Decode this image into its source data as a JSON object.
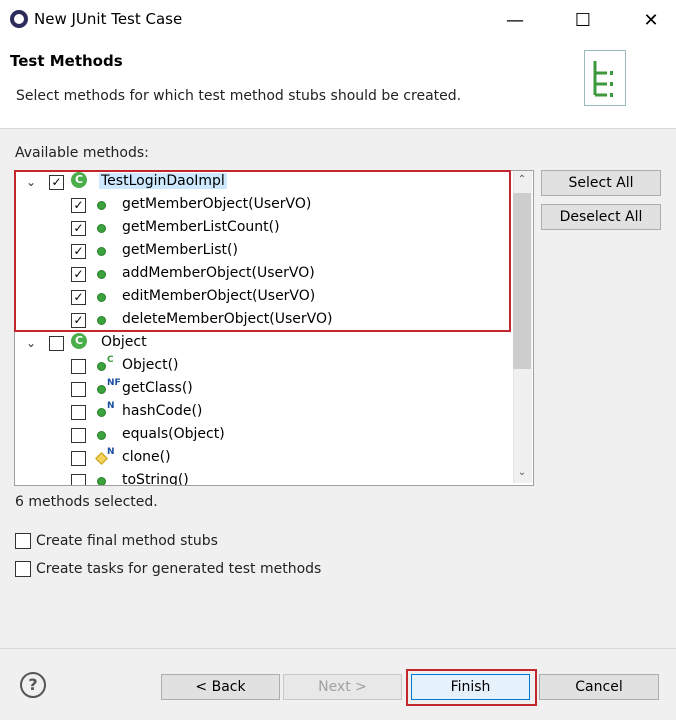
{
  "window": {
    "title": "New JUnit Test Case"
  },
  "header": {
    "title": "Test Methods",
    "description": "Select methods for which test method stubs should be created."
  },
  "main": {
    "available_label": "Available methods:",
    "selection_status": "6 methods selected."
  },
  "tree": {
    "class_node": {
      "name": "TestLoginDaoImpl",
      "checked": true,
      "expanded": true
    },
    "class_methods": [
      "getMemberObject(UserVO)",
      "getMemberListCount()",
      "getMemberList()",
      "addMemberObject(UserVO)",
      "editMemberObject(UserVO)",
      "deleteMemberObject(UserVO)"
    ],
    "object_node": {
      "name": "Object",
      "checked": false,
      "expanded": true
    },
    "object_methods": [
      {
        "label": "Object()",
        "badge": "C"
      },
      {
        "label": "getClass()",
        "badge": "NF"
      },
      {
        "label": "hashCode()",
        "badge": "N"
      },
      {
        "label": "equals(Object)",
        "badge": ""
      },
      {
        "label": "clone()",
        "badge": "N"
      },
      {
        "label": "toString()",
        "badge": ""
      }
    ]
  },
  "side_buttons": {
    "select_all": "Select All",
    "deselect_all": "Deselect All"
  },
  "options": {
    "final_stubs": "Create final method stubs",
    "tasks": "Create tasks for generated test methods"
  },
  "footer": {
    "back": "< Back",
    "next": "Next >",
    "finish": "Finish",
    "cancel": "Cancel"
  },
  "icons": {
    "app": "eclipse-icon",
    "minimize": "minimize-icon",
    "maximize": "maximize-icon",
    "close": "close-icon",
    "help": "help-icon",
    "header_graphic": "test-tree-icon"
  }
}
